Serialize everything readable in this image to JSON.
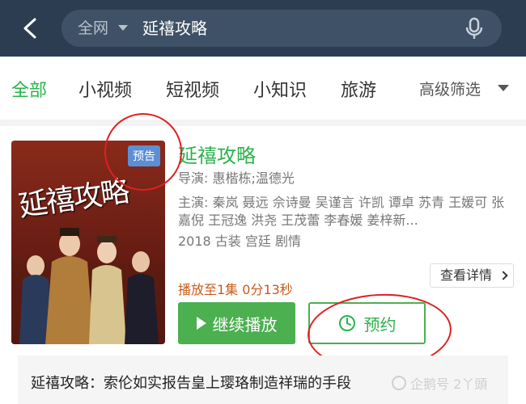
{
  "search": {
    "scope": "全网",
    "query": "延禧攻略"
  },
  "tabs": [
    {
      "label": "全部",
      "active": true
    },
    {
      "label": "小视频"
    },
    {
      "label": "短视频"
    },
    {
      "label": "小知识"
    },
    {
      "label": "旅游"
    }
  ],
  "filter_label": "高级筛选",
  "result": {
    "badge": "预告",
    "poster_title": "延禧攻略",
    "title": "延禧攻略",
    "director": "导演: 惠楷栋;温德光",
    "cast": "主演: 秦岚 聂远 佘诗曼 吴谨言 许凯 谭卓 苏青 王媛可 张嘉倪 王冠逸 洪尧 王茂蕾 李春媛 姜梓新...",
    "tags": "2018 古装 宫廷 剧情",
    "detail_button": "查看详情",
    "progress": "播放至1集 0分13秒",
    "play_button": "继续播放",
    "reserve_button": "预约"
  },
  "related": "延禧攻略：索伦如实报告皇上璎珞制造祥瑞的手段",
  "watermark": "企鹅号 2丫頭",
  "colors": {
    "accent": "#2bb24c",
    "topbar": "#2c3d52",
    "progress": "#c95a1a",
    "badge": "#5b8fd6",
    "annotation": "#e02020"
  }
}
